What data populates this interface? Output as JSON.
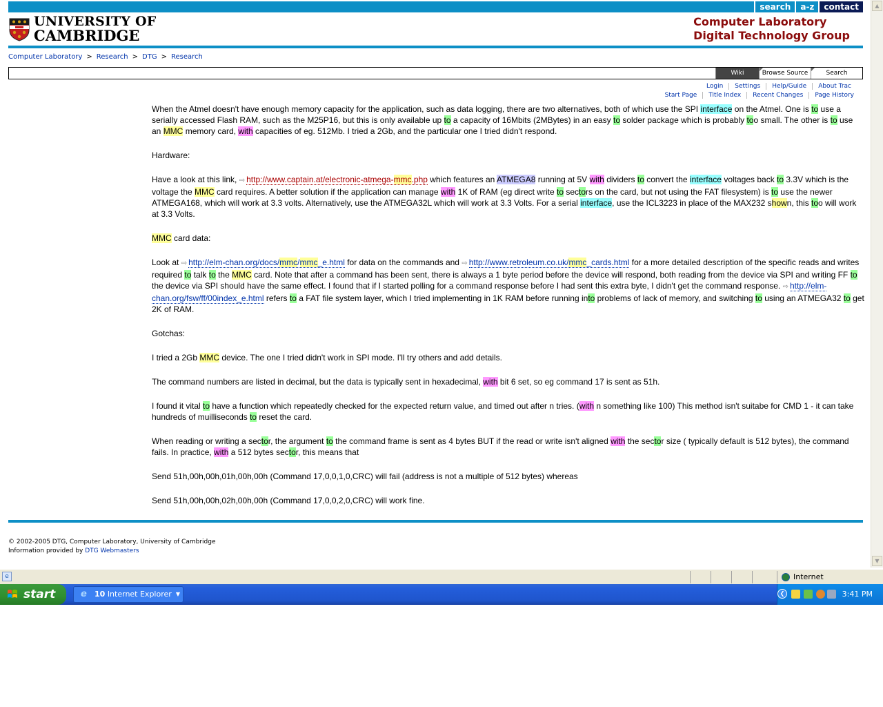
{
  "header": {
    "top_links": [
      "search",
      "a-z",
      "contact"
    ],
    "university_line1": "UNIVERSITY OF",
    "university_line2": "CAMBRIDGE",
    "group_line1": "Computer Laboratory",
    "group_line2": "Digital Technology Group"
  },
  "breadcrumb": [
    "Computer Laboratory",
    "Research",
    "DTG",
    "Research"
  ],
  "breadcrumb_sep": ">",
  "trac_nav": [
    "Wiki",
    "Browse Source",
    "Search"
  ],
  "meta_nav": [
    "Login",
    "Settings",
    "Help/Guide",
    "About Trac"
  ],
  "ctx_nav": [
    "Start Page",
    "Title Index",
    "Recent Changes",
    "Page History"
  ],
  "content": {
    "p1": {
      "a": "When the Atmel doesn't have enough memory capacity for the application, such as data logging, there are two alternatives, both of which use the SPI ",
      "interface": "interface",
      "b": " on the Atmel. One is ",
      "to1": "to",
      "c": " use a serially accessed Flash RAM, such as the M25P16, but this is only available up ",
      "to2": "to",
      "d": " a capacity of 16Mbits (2MBytes) in an easy ",
      "to3": "to",
      "e": " solder package which is probably ",
      "to4": "to",
      "f": "o small. The other is ",
      "to5": "to",
      "g": " use an ",
      "mmc": "MMC",
      "h": " memory card, ",
      "with": "with",
      "i": " capacities of eg. 512Mb. I tried a 2Gb, and the particular one I tried didn't respond."
    },
    "hardware": "Hardware:",
    "p2": {
      "a": "Have a look at this link, ",
      "link_pre": "http://www.captain.at/electronic-atmega-",
      "link_mmc": "mmc",
      "link_post": ".php",
      "b": " which features an ",
      "atmega8": "ATMEGA8",
      "c": " running at 5V ",
      "with1": "with",
      "d": " dividers ",
      "to1": "to",
      "e": " convert the ",
      "interface1": "interface",
      "f": " voltages back ",
      "to2": "to",
      "g": " 3.3V which is the voltage the ",
      "mmc": "MMC",
      "h": " card requires. A better solution if the application can manage ",
      "with2": "with",
      "i": " 1K of RAM (eg direct write ",
      "to3": "to",
      "j": " sec",
      "to4": "to",
      "k": "rs on the card, but not using the FAT filesystem) is ",
      "to5": "to",
      "l": " use the newer ATMEGA168, which will work at 3.3 volts. Alternatively, use the ATMEGA32L which will work at 3.3 Volts. For a serial ",
      "interface2": "interface",
      "m": ", use the ICL3223 in place of the MAX232 s",
      "how": "how",
      "n": "n, this ",
      "to6": "to",
      "o": "o will work at 3.3 Volts."
    },
    "mmc_heading": {
      "mmc": "MMC",
      "rest": " card data:"
    },
    "p3": {
      "a": "Look at ",
      "l1_pre": "http://elm-chan.org/docs/",
      "l1_mmc1": "mmc",
      "l1_mid": "/",
      "l1_mmc2": "mmc",
      "l1_post": "_e.html",
      "b": " for data on the commands and ",
      "l2_pre": "http://www.retroleum.co.uk/",
      "l2_mmc": "mmc",
      "l2_post": "_cards.html",
      "c": " for a more detailed description of the specific reads and writes required ",
      "to1": "to",
      "d": " talk ",
      "to2": "to",
      "e": " the ",
      "mmc": "MMC",
      "f": " card. Note that after a command has been sent, there is always a 1 byte period before the device will respond, both reading from the device via SPI and writing FF ",
      "to3": "to",
      "g": " the device via SPI should have the same effect. I found that if I started polling for a command response before I had sent this extra byte, I didn't get the command response. ",
      "l3": "http://elm-chan.org/fsw/ff/00index_e.html",
      "h": " refers ",
      "to4": "to",
      "i": " a FAT file system layer, which I tried implementing in 1K RAM before running in",
      "to5": "to",
      "j": " problems of lack of memory, and switching ",
      "to6": "to",
      "k": " using an ATMEGA32 ",
      "to7": "to",
      "l": " get 2K of RAM."
    },
    "gotchas": "Gotchas:",
    "p4": {
      "a": "I tried a 2Gb ",
      "mmc": "MMC",
      "b": " device. The one I tried didn't work in SPI mode. I'll try others and add details."
    },
    "p5": {
      "a": "The command numbers are listed in decimal, but the data is typically sent in hexadecimal, ",
      "with": "with",
      "b": " bit 6 set, so eg command 17 is sent as 51h."
    },
    "p6": {
      "a": "I found it vital ",
      "to1": "to",
      "b": " have a function which repeatedly checked for the expected return value, and timed out after n tries. (",
      "with": "with",
      "c": " n something like 100) This method isn't suitabe for CMD 1 - it can take hundreds of muilliseconds ",
      "to2": "to",
      "d": " reset the card."
    },
    "p7": {
      "a": "When reading or writing a sec",
      "to1": "to",
      "b": "r, the argument ",
      "to2": "to",
      "c": " the command frame is sent as 4 bytes BUT if the read or write isn't aligned ",
      "with1": "with",
      "d": " the sec",
      "to3": "to",
      "e": "r size ( typically default is 512 bytes), the command fails. In practice, ",
      "with2": "with",
      "f": " a 512 bytes sec",
      "to4": "to",
      "g": "r, this means that"
    },
    "p8": "Send 51h,00h,00h,01h,00h,00h (Command 17,0,0,1,0,CRC) will fail (address is not a multiple of 512 bytes) whereas",
    "p9": "Send 51h,00h,00h,02h,00h,00h (Command 17,0,0,2,0,CRC) will work fine."
  },
  "footer": {
    "line1": "© 2002-2005 DTG, Computer Laboratory, University of Cambridge",
    "line2_pre": "Information provided by ",
    "line2_link": "DTG Webmasters"
  },
  "statusbar": {
    "zone": "Internet"
  },
  "taskbar": {
    "start": "start",
    "ie_count": "10",
    "ie_label": "Internet Explorer",
    "clock": "3:41 PM"
  },
  "colors": {
    "cambridge_blue": "#0d8fc6",
    "group_red": "#8b0c0c",
    "link": "#0033aa",
    "highlight_mmc": "#ffff99",
    "highlight_to": "#99ff99",
    "highlight_interface": "#99ffff",
    "highlight_with": "#ff99ff",
    "highlight_atmega8": "#ccccff"
  }
}
